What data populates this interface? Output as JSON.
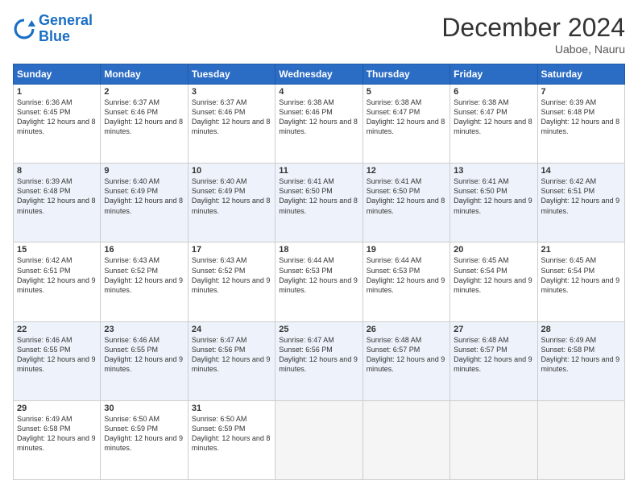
{
  "logo": {
    "line1": "General",
    "line2": "Blue"
  },
  "title": "December 2024",
  "location": "Uaboe, Nauru",
  "days_of_week": [
    "Sunday",
    "Monday",
    "Tuesday",
    "Wednesday",
    "Thursday",
    "Friday",
    "Saturday"
  ],
  "weeks": [
    [
      {
        "day": "1",
        "sunrise": "6:36 AM",
        "sunset": "6:45 PM",
        "daylight": "12 hours and 8 minutes."
      },
      {
        "day": "2",
        "sunrise": "6:37 AM",
        "sunset": "6:46 PM",
        "daylight": "12 hours and 8 minutes."
      },
      {
        "day": "3",
        "sunrise": "6:37 AM",
        "sunset": "6:46 PM",
        "daylight": "12 hours and 8 minutes."
      },
      {
        "day": "4",
        "sunrise": "6:38 AM",
        "sunset": "6:46 PM",
        "daylight": "12 hours and 8 minutes."
      },
      {
        "day": "5",
        "sunrise": "6:38 AM",
        "sunset": "6:47 PM",
        "daylight": "12 hours and 8 minutes."
      },
      {
        "day": "6",
        "sunrise": "6:38 AM",
        "sunset": "6:47 PM",
        "daylight": "12 hours and 8 minutes."
      },
      {
        "day": "7",
        "sunrise": "6:39 AM",
        "sunset": "6:48 PM",
        "daylight": "12 hours and 8 minutes."
      }
    ],
    [
      {
        "day": "8",
        "sunrise": "6:39 AM",
        "sunset": "6:48 PM",
        "daylight": "12 hours and 8 minutes."
      },
      {
        "day": "9",
        "sunrise": "6:40 AM",
        "sunset": "6:49 PM",
        "daylight": "12 hours and 8 minutes."
      },
      {
        "day": "10",
        "sunrise": "6:40 AM",
        "sunset": "6:49 PM",
        "daylight": "12 hours and 8 minutes."
      },
      {
        "day": "11",
        "sunrise": "6:41 AM",
        "sunset": "6:50 PM",
        "daylight": "12 hours and 8 minutes."
      },
      {
        "day": "12",
        "sunrise": "6:41 AM",
        "sunset": "6:50 PM",
        "daylight": "12 hours and 8 minutes."
      },
      {
        "day": "13",
        "sunrise": "6:41 AM",
        "sunset": "6:50 PM",
        "daylight": "12 hours and 9 minutes."
      },
      {
        "day": "14",
        "sunrise": "6:42 AM",
        "sunset": "6:51 PM",
        "daylight": "12 hours and 9 minutes."
      }
    ],
    [
      {
        "day": "15",
        "sunrise": "6:42 AM",
        "sunset": "6:51 PM",
        "daylight": "12 hours and 9 minutes."
      },
      {
        "day": "16",
        "sunrise": "6:43 AM",
        "sunset": "6:52 PM",
        "daylight": "12 hours and 9 minutes."
      },
      {
        "day": "17",
        "sunrise": "6:43 AM",
        "sunset": "6:52 PM",
        "daylight": "12 hours and 9 minutes."
      },
      {
        "day": "18",
        "sunrise": "6:44 AM",
        "sunset": "6:53 PM",
        "daylight": "12 hours and 9 minutes."
      },
      {
        "day": "19",
        "sunrise": "6:44 AM",
        "sunset": "6:53 PM",
        "daylight": "12 hours and 9 minutes."
      },
      {
        "day": "20",
        "sunrise": "6:45 AM",
        "sunset": "6:54 PM",
        "daylight": "12 hours and 9 minutes."
      },
      {
        "day": "21",
        "sunrise": "6:45 AM",
        "sunset": "6:54 PM",
        "daylight": "12 hours and 9 minutes."
      }
    ],
    [
      {
        "day": "22",
        "sunrise": "6:46 AM",
        "sunset": "6:55 PM",
        "daylight": "12 hours and 9 minutes."
      },
      {
        "day": "23",
        "sunrise": "6:46 AM",
        "sunset": "6:55 PM",
        "daylight": "12 hours and 9 minutes."
      },
      {
        "day": "24",
        "sunrise": "6:47 AM",
        "sunset": "6:56 PM",
        "daylight": "12 hours and 9 minutes."
      },
      {
        "day": "25",
        "sunrise": "6:47 AM",
        "sunset": "6:56 PM",
        "daylight": "12 hours and 9 minutes."
      },
      {
        "day": "26",
        "sunrise": "6:48 AM",
        "sunset": "6:57 PM",
        "daylight": "12 hours and 9 minutes."
      },
      {
        "day": "27",
        "sunrise": "6:48 AM",
        "sunset": "6:57 PM",
        "daylight": "12 hours and 9 minutes."
      },
      {
        "day": "28",
        "sunrise": "6:49 AM",
        "sunset": "6:58 PM",
        "daylight": "12 hours and 9 minutes."
      }
    ],
    [
      {
        "day": "29",
        "sunrise": "6:49 AM",
        "sunset": "6:58 PM",
        "daylight": "12 hours and 9 minutes."
      },
      {
        "day": "30",
        "sunrise": "6:50 AM",
        "sunset": "6:59 PM",
        "daylight": "12 hours and 9 minutes."
      },
      {
        "day": "31",
        "sunrise": "6:50 AM",
        "sunset": "6:59 PM",
        "daylight": "12 hours and 8 minutes."
      },
      null,
      null,
      null,
      null
    ]
  ],
  "labels": {
    "sunrise": "Sunrise:",
    "sunset": "Sunset:",
    "daylight": "Daylight:"
  }
}
